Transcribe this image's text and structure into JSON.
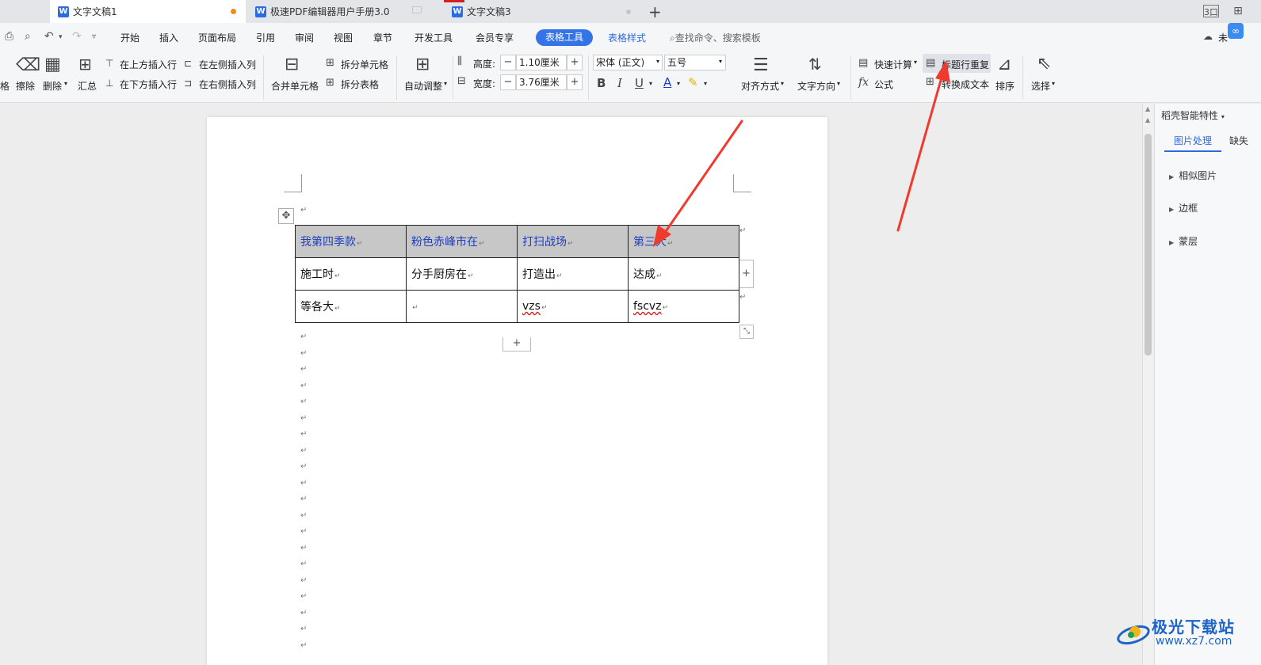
{
  "tabs": [
    {
      "label": "文字文稿1"
    },
    {
      "label": "极速PDF编辑器用户手册3.0"
    },
    {
      "label": "文字文稿3"
    }
  ],
  "window": {
    "view_label": "3口"
  },
  "menu": {
    "items": [
      "开始",
      "插入",
      "页面布局",
      "引用",
      "审阅",
      "视图",
      "章节",
      "开发工具",
      "会员专享"
    ],
    "active": "表格工具",
    "table_style": "表格样式",
    "search": "查找命令、搜索模板",
    "cloud_label": "未"
  },
  "ribbon": {
    "cut_label": "格",
    "erase": "擦除",
    "delete": "删除",
    "summary": "汇总",
    "insert_above": "在上方插入行",
    "insert_below": "在下方插入行",
    "insert_left": "在左侧插入列",
    "insert_right": "在右侧插入列",
    "merge": "合并单元格",
    "split_cell": "拆分单元格",
    "split_table": "拆分表格",
    "autofit": "自动调整",
    "height_label": "高度:",
    "height_value": "1.10厘米",
    "width_label": "宽度:",
    "width_value": "3.76厘米",
    "font_name": "宋体 (正文)",
    "font_size": "五号",
    "align": "对齐方式",
    "text_dir": "文字方向",
    "quick_calc": "快速计算",
    "formula": "公式",
    "header_repeat": "标题行重复",
    "to_text": "转换成文本",
    "sort": "排序",
    "select": "选择"
  },
  "document": {
    "table": {
      "rows": [
        [
          "我第四季款",
          "粉色赤峰市在",
          "打扫战场",
          "第三大"
        ],
        [
          "施工时",
          "分手厨房在",
          "打造出",
          "达成"
        ],
        [
          "等各大",
          "",
          "vzs",
          "fscvz"
        ]
      ]
    },
    "paragraph_mark": "↵"
  },
  "side_panel": {
    "title": "稻壳智能特性",
    "tab_active": "图片处理",
    "tab_other": "缺失",
    "items": [
      "相似图片",
      "边框",
      "蒙层"
    ]
  },
  "watermark": {
    "name": "极光下载站",
    "url": "www.xz7.com"
  },
  "colors": {
    "accent": "#3574e8",
    "header_fill": "#c7c7c7",
    "header_text": "#1d3fbf",
    "arrow": "#f03a2e"
  }
}
